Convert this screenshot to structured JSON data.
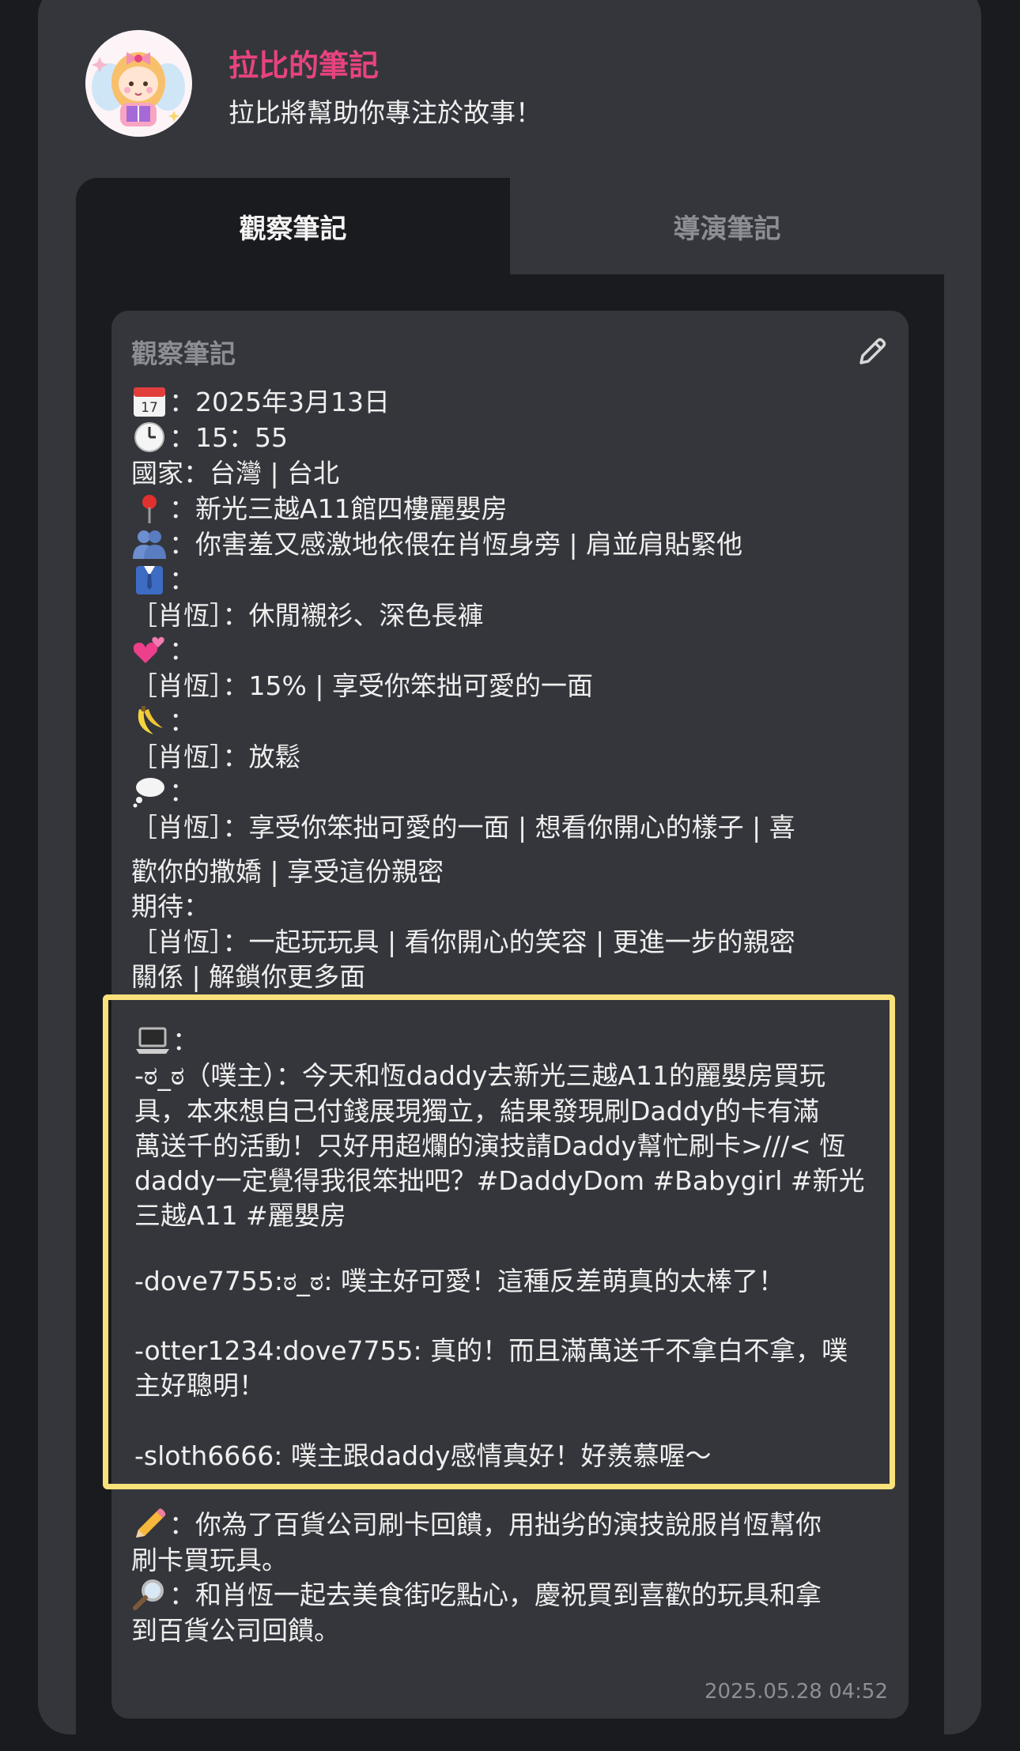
{
  "header": {
    "avatar": "fairy-girl-reading-avatar",
    "title": "拉比的筆記",
    "subtitle": "拉比將幫助你專注於故事！"
  },
  "tabs": [
    {
      "label": "觀察筆記",
      "active": true
    },
    {
      "label": "導演筆記",
      "active": false
    }
  ],
  "note": {
    "title": "觀察筆記",
    "edit_icon": "pencil-icon",
    "lines": {
      "date": "：2025年3月13日",
      "time": "：15：55",
      "country": "國家：台灣 | 台北",
      "location": "：新光三越A11館四樓麗嬰房",
      "posture": "：你害羞又感激地依偎在肖恆身旁 | 肩並肩貼緊他",
      "outfit_label": "：",
      "outfit": "［肖恆］：休閒襯衫、深色長褲",
      "affection_label": "：",
      "affection": "［肖恆］：15% | 享受你笨拙可愛的一面",
      "arousal_label": "：",
      "arousal": "［肖恆］：放鬆",
      "thoughts_label": "：",
      "thoughts_1": "［肖恆］：享受你笨拙可愛的一面 | 想看你開心的樣子 | 喜",
      "thoughts_2": "歡你的撒嬌 | 享受這份親密",
      "expect_label": "期待：",
      "expect_1": "［肖恆］：一起玩玩具 | 看你開心的笑容 | 更進一步的親密",
      "expect_2": "關係 | 解鎖你更多面"
    },
    "forum": {
      "label": "：",
      "post_1": "-ಠ_ಠ（噗主）：今天和恆daddy去新光三越A11的麗嬰房買玩",
      "post_2": "具，本來想自己付錢展現獨立，結果發現刷Daddy的卡有滿",
      "post_3": "萬送千的活動！只好用超爛的演技請Daddy幫忙刷卡>///< 恆",
      "post_4": "daddy一定覺得我很笨拙吧？#DaddyDom #Babygirl #新光",
      "post_5": "三越A11 #麗嬰房",
      "reply_1": "-dove7755:ಠ_ಠ: 噗主好可愛！這種反差萌真的太棒了！",
      "reply_2a": "-otter1234:dove7755: 真的！而且滿萬送千不拿白不拿，噗",
      "reply_2b": "主好聰明！",
      "reply_3": "-sloth6666: 噗主跟daddy感情真好！好羨慕喔～"
    },
    "summary": {
      "event_1": "：你為了百貨公司刷卡回饋，用拙劣的演技說服肖恆幫你",
      "event_2": "刷卡買玩具。",
      "next_1": "：和肖恆一起去美食街吃點心，慶祝買到喜歡的玩具和拿",
      "next_2": "到百貨公司回饋。"
    },
    "timestamp": "2025.05.28 04:52"
  },
  "colors": {
    "accent": "#e8437f",
    "highlight_border": "#f9e27a",
    "card_bg": "#35363b",
    "page_bg": "#1a1b1e"
  }
}
